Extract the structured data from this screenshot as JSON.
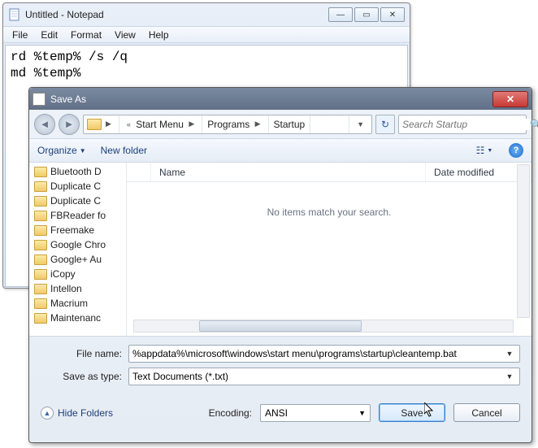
{
  "notepad": {
    "title": "Untitled - Notepad",
    "menu": [
      "File",
      "Edit",
      "Format",
      "View",
      "Help"
    ],
    "content": "rd %temp% /s /q\nmd %temp%"
  },
  "saveas": {
    "title": "Save As",
    "breadcrumb": [
      "Start Menu",
      "Programs",
      "Startup"
    ],
    "search_placeholder": "Search Startup",
    "toolbar": {
      "organize": "Organize",
      "newfolder": "New folder"
    },
    "tree_items": [
      "Bluetooth D",
      "Duplicate C",
      "Duplicate C",
      "FBReader fo",
      "Freemake",
      "Google Chro",
      "Google+ Au",
      "iCopy",
      "Intellon",
      "Macrium",
      "Maintenanc"
    ],
    "columns": {
      "name": "Name",
      "date": "Date modified"
    },
    "empty_msg": "No items match your search.",
    "filename_label": "File name:",
    "filename_value": "%appdata%\\microsoft\\windows\\start menu\\programs\\startup\\cleantemp.bat",
    "savetype_label": "Save as type:",
    "savetype_value": "Text Documents (*.txt)",
    "encoding_label": "Encoding:",
    "encoding_value": "ANSI",
    "hide_folders": "Hide Folders",
    "save": "Save",
    "cancel": "Cancel"
  }
}
